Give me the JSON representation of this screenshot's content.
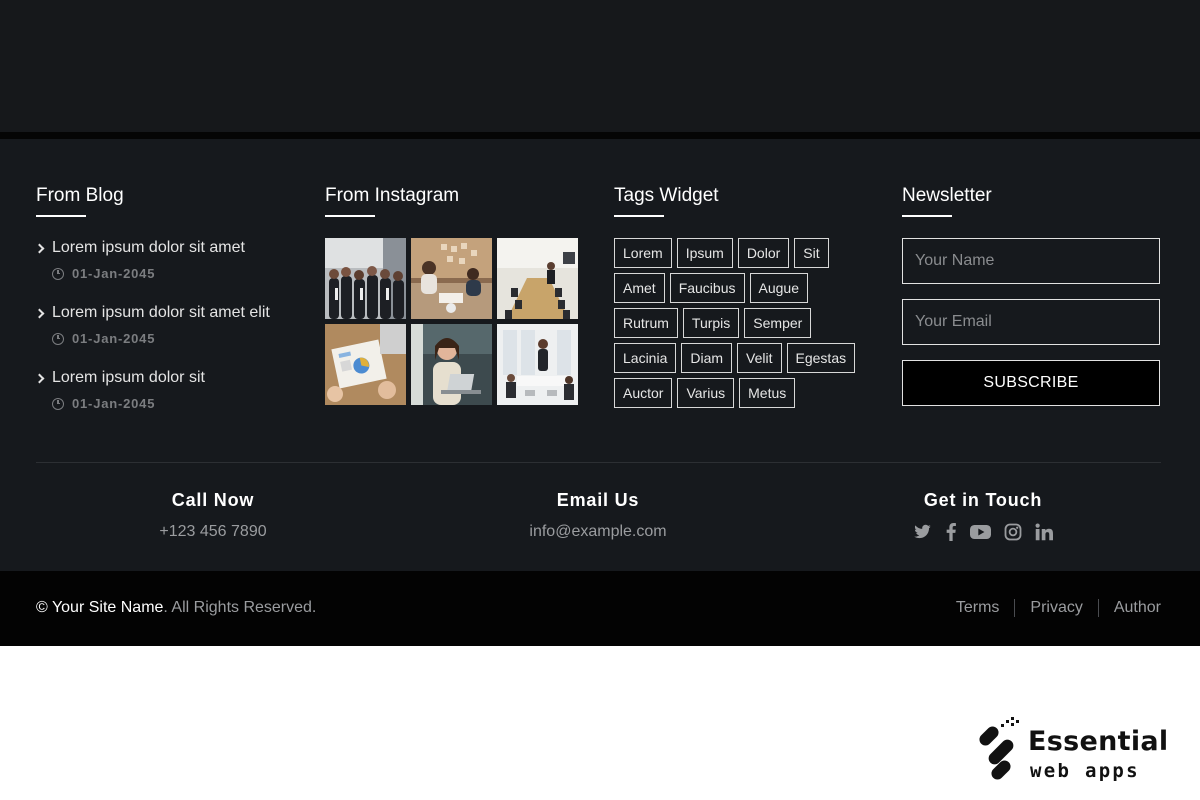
{
  "blog": {
    "title": "From Blog",
    "items": [
      {
        "title": "Lorem ipsum dolor sit amet",
        "date": "01-Jan-2045"
      },
      {
        "title": "Lorem ipsum dolor sit amet elit",
        "date": "01-Jan-2045"
      },
      {
        "title": "Lorem ipsum dolor sit",
        "date": "01-Jan-2045"
      }
    ]
  },
  "instagram": {
    "title": "From Instagram",
    "photos": [
      "business-team-photo",
      "meeting-table-photo",
      "conference-room-photo",
      "documents-desk-photo",
      "woman-laptop-photo",
      "office-presentation-photo"
    ]
  },
  "tags": {
    "title": "Tags Widget",
    "items": [
      "Lorem",
      "Ipsum",
      "Dolor",
      "Sit",
      "Amet",
      "Faucibus",
      "Augue",
      "Rutrum",
      "Turpis",
      "Semper",
      "Lacinia",
      "Diam",
      "Velit",
      "Egestas",
      "Auctor",
      "Varius",
      "Metus"
    ]
  },
  "newsletter": {
    "title": "Newsletter",
    "name_placeholder": "Your Name",
    "email_placeholder": "Your Email",
    "subscribe_label": "SUBSCRIBE"
  },
  "contact": {
    "call": {
      "title": "Call Now",
      "value": "+123 456 7890"
    },
    "email": {
      "title": "Email Us",
      "value": "info@example.com"
    },
    "touch": {
      "title": "Get in Touch",
      "icons": [
        "twitter-icon",
        "facebook-icon",
        "youtube-icon",
        "instagram-icon",
        "linkedin-icon"
      ]
    }
  },
  "bottom": {
    "copyright_symbol": "©",
    "site_name": "Your Site Name",
    "rights": ". All Rights Reserved.",
    "links": [
      "Terms",
      "Privacy",
      "Author"
    ]
  },
  "watermark": {
    "line1": "Essential",
    "line2": "web apps"
  },
  "colors": {
    "footer_bg": "#16191d",
    "bottom_bar_bg": "#030303",
    "text_muted": "#9a9c9f"
  }
}
